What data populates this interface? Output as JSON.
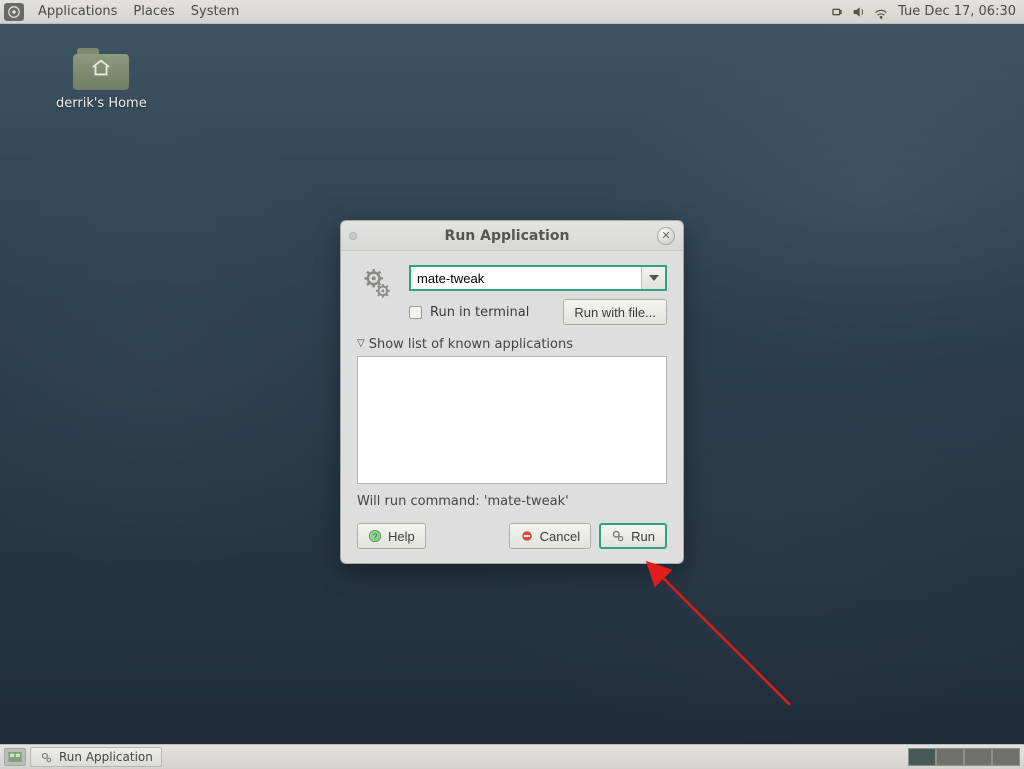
{
  "panel": {
    "menus": [
      "Applications",
      "Places",
      "System"
    ],
    "clock": "Tue Dec 17, 06:30"
  },
  "desktop": {
    "home_label": "derrik's Home"
  },
  "dialog": {
    "title": "Run Application",
    "command_value": "mate-tweak",
    "run_in_terminal_label": "Run in terminal",
    "run_with_file_label": "Run with file...",
    "expander_label": "Show list of known applications",
    "status_text": "Will run command: 'mate-tweak'",
    "help_label": "Help",
    "cancel_label": "Cancel",
    "run_label": "Run"
  },
  "taskbar": {
    "task_label": "Run Application"
  }
}
